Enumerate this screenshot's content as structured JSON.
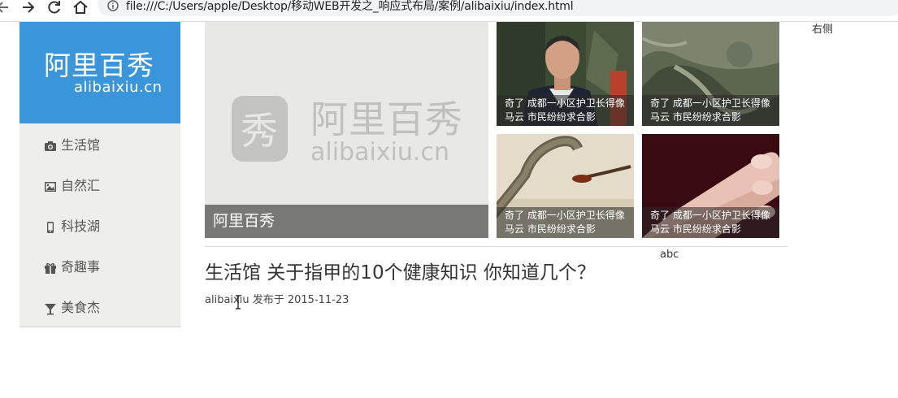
{
  "browser": {
    "url": "file:///C:/Users/apple/Desktop/移动WEB开发之_响应式布局/案例/alibaixiu/index.html",
    "icons": [
      "back-icon",
      "forward-icon",
      "reload-icon",
      "home-icon",
      "info-icon"
    ]
  },
  "sidebar": {
    "logo_cn": "阿里百秀",
    "logo_en": "alibaixiu.cn",
    "logo_bg": "#3a95db",
    "items": [
      {
        "label": "生活馆",
        "icon": "camera-icon"
      },
      {
        "label": "自然汇",
        "icon": "picture-icon"
      },
      {
        "label": "科技湖",
        "icon": "phone-icon"
      },
      {
        "label": "奇趣事",
        "icon": "gift-icon"
      },
      {
        "label": "美食杰",
        "icon": "cocktail-icon"
      }
    ]
  },
  "banner": {
    "caption": "阿里百秀",
    "watermark_cn": "阿里百秀",
    "watermark_en": "alibaixiu.cn",
    "watermark_mark": "秀"
  },
  "thumbnails": [
    {
      "line1": "奇了 成都一小区护卫长得像",
      "line2": "马云 市民纷纷求合影",
      "image": "man-portrait"
    },
    {
      "line1": "奇了 成都一小区护卫长得像",
      "line2": "马云 市民纷纷求合影",
      "image": "aerial-landscape"
    },
    {
      "line1": "奇了 成都一小区护卫长得像",
      "line2": "马云 市民纷纷求合影",
      "image": "snake"
    },
    {
      "line1": "奇了 成都一小区护卫长得像",
      "line2": "马云 市民纷纷求合影",
      "image": "fingernails"
    }
  ],
  "right_label": "右侧",
  "abc_label": "abc",
  "article": {
    "title": "生活馆 关于指甲的10个健康知识 你知道几个？",
    "meta": "alibaixiu 发布于 2015-11-23"
  }
}
